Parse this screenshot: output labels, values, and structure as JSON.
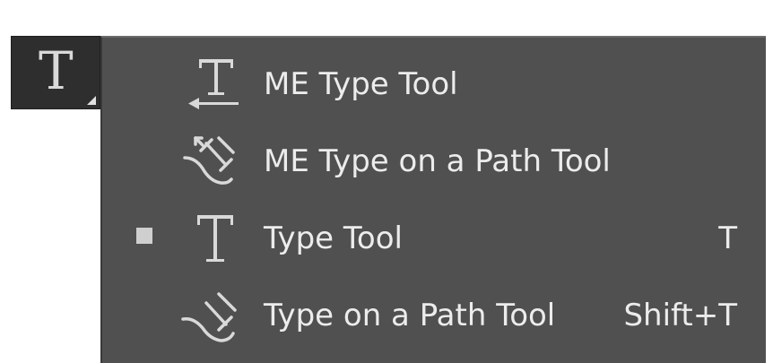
{
  "toolbar": {
    "type_tool_button": {
      "glyph": "T",
      "icon": "type-tool-icon",
      "has_flyout_indicator": true
    }
  },
  "flyout_menu": {
    "items": [
      {
        "label": "ME Type Tool",
        "shortcut": "",
        "icon": "me-type-tool-icon",
        "selected": false
      },
      {
        "label": "ME Type on a Path Tool",
        "shortcut": "",
        "icon": "me-type-on-path-tool-icon",
        "selected": false
      },
      {
        "label": "Type Tool",
        "shortcut": "T",
        "icon": "type-tool-icon",
        "selected": true
      },
      {
        "label": "Type on a Path Tool",
        "shortcut": "Shift+T",
        "icon": "type-on-path-tool-icon",
        "selected": false
      }
    ]
  },
  "colors": {
    "menu_background": "#505050",
    "button_background": "#2e2e2e",
    "text": "#ececec",
    "icon": "#d9d9d9"
  }
}
